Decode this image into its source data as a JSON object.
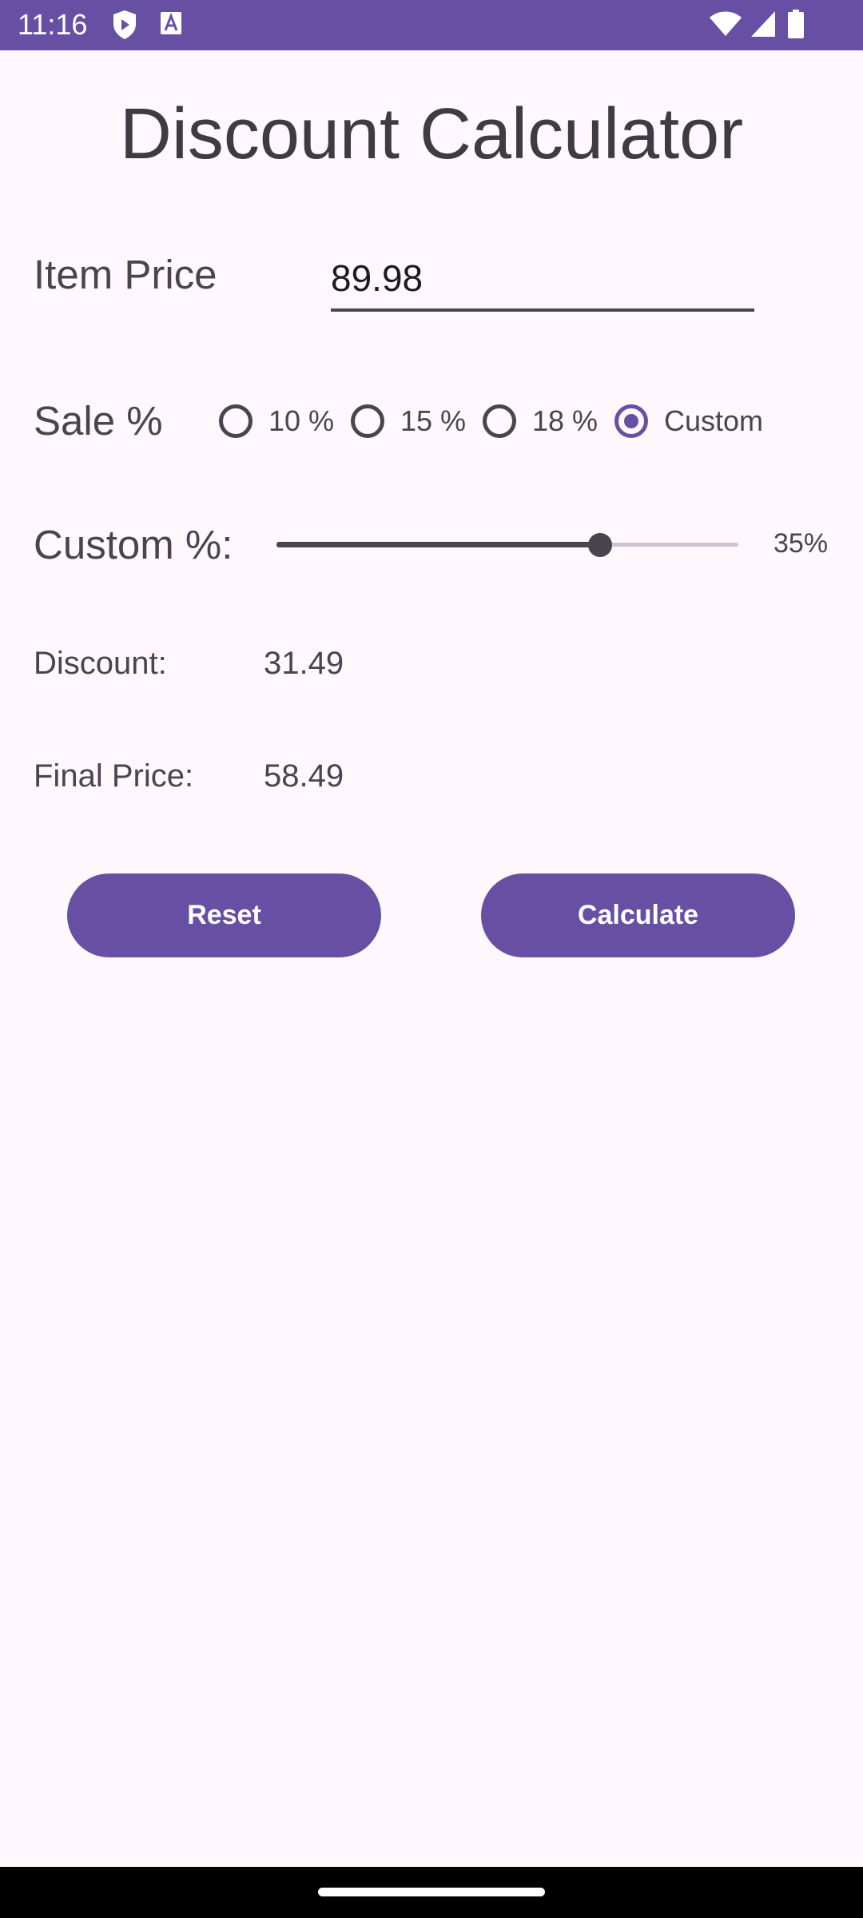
{
  "status_bar": {
    "time": "11:16",
    "left_icons": [
      "shield-play-icon",
      "font-a-icon"
    ],
    "right_icons": [
      "wifi-icon",
      "cellular-signal-icon",
      "battery-icon"
    ]
  },
  "app": {
    "title": "Discount Calculator"
  },
  "item_price": {
    "label": "Item Price",
    "value": "89.98"
  },
  "sale": {
    "label": "Sale %",
    "options": [
      {
        "label": "10 %",
        "checked": false
      },
      {
        "label": "15 %",
        "checked": false
      },
      {
        "label": "18 %",
        "checked": false
      },
      {
        "label": "Custom",
        "checked": true
      }
    ]
  },
  "custom_percent": {
    "label": "Custom %:",
    "value": 35,
    "min": 0,
    "max": 50,
    "value_text": "35%"
  },
  "results": {
    "discount_label": "Discount:",
    "discount_value": "31.49",
    "final_price_label": "Final Price:",
    "final_price_value": "58.49"
  },
  "buttons": {
    "reset_label": "Reset",
    "calculate_label": "Calculate"
  },
  "colors": {
    "primary": "#6750a4",
    "background": "#fef7fb",
    "text": "#49454f"
  }
}
